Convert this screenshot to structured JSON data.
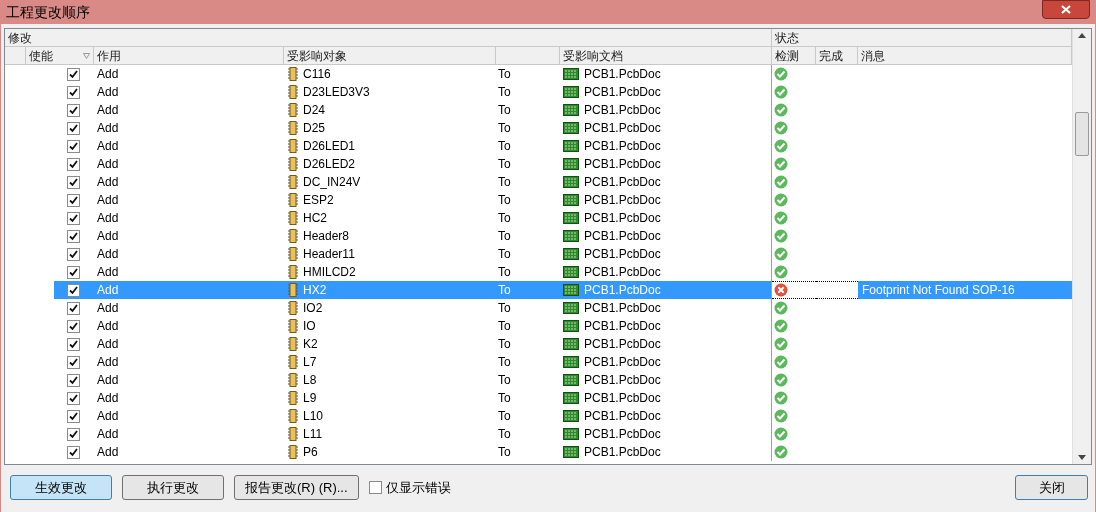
{
  "window": {
    "title": "工程更改顺序"
  },
  "groups": [
    "修改",
    "状态"
  ],
  "columns": [
    "使能",
    "作用",
    "受影响对象",
    "受影响文档",
    "检测",
    "完成",
    "消息"
  ],
  "rows": [
    {
      "enabled": true,
      "action": "Add",
      "object": "C116",
      "to": "To",
      "document": "PCB1.PcbDoc",
      "check": {
        "kind": "ok"
      },
      "selected": false
    },
    {
      "enabled": true,
      "action": "Add",
      "object": "D23LED3V3",
      "to": "To",
      "document": "PCB1.PcbDoc",
      "check": {
        "kind": "ok"
      },
      "selected": false
    },
    {
      "enabled": true,
      "action": "Add",
      "object": "D24",
      "to": "To",
      "document": "PCB1.PcbDoc",
      "check": {
        "kind": "ok"
      },
      "selected": false
    },
    {
      "enabled": true,
      "action": "Add",
      "object": "D25",
      "to": "To",
      "document": "PCB1.PcbDoc",
      "check": {
        "kind": "ok"
      },
      "selected": false
    },
    {
      "enabled": true,
      "action": "Add",
      "object": "D26LED1",
      "to": "To",
      "document": "PCB1.PcbDoc",
      "check": {
        "kind": "ok"
      },
      "selected": false
    },
    {
      "enabled": true,
      "action": "Add",
      "object": "D26LED2",
      "to": "To",
      "document": "PCB1.PcbDoc",
      "check": {
        "kind": "ok"
      },
      "selected": false
    },
    {
      "enabled": true,
      "action": "Add",
      "object": "DC_IN24V",
      "to": "To",
      "document": "PCB1.PcbDoc",
      "check": {
        "kind": "ok"
      },
      "selected": false
    },
    {
      "enabled": true,
      "action": "Add",
      "object": "ESP2",
      "to": "To",
      "document": "PCB1.PcbDoc",
      "check": {
        "kind": "ok"
      },
      "selected": false
    },
    {
      "enabled": true,
      "action": "Add",
      "object": "HC2",
      "to": "To",
      "document": "PCB1.PcbDoc",
      "check": {
        "kind": "ok"
      },
      "selected": false
    },
    {
      "enabled": true,
      "action": "Add",
      "object": "Header8",
      "to": "To",
      "document": "PCB1.PcbDoc",
      "check": {
        "kind": "ok"
      },
      "selected": false
    },
    {
      "enabled": true,
      "action": "Add",
      "object": "Header11",
      "to": "To",
      "document": "PCB1.PcbDoc",
      "check": {
        "kind": "ok"
      },
      "selected": false
    },
    {
      "enabled": true,
      "action": "Add",
      "object": "HMILCD2",
      "to": "To",
      "document": "PCB1.PcbDoc",
      "check": {
        "kind": "ok"
      },
      "selected": false
    },
    {
      "enabled": true,
      "action": "Add",
      "object": "HX2",
      "to": "To",
      "document": "PCB1.PcbDoc",
      "check": {
        "kind": "error"
      },
      "message": "Footprint Not Found SOP-16",
      "selected": true
    },
    {
      "enabled": true,
      "action": "Add",
      "object": "IO2",
      "to": "To",
      "document": "PCB1.PcbDoc",
      "check": {
        "kind": "ok"
      },
      "selected": false
    },
    {
      "enabled": true,
      "action": "Add",
      "object": "IO",
      "to": "To",
      "document": "PCB1.PcbDoc",
      "check": {
        "kind": "ok"
      },
      "selected": false
    },
    {
      "enabled": true,
      "action": "Add",
      "object": "K2",
      "to": "To",
      "document": "PCB1.PcbDoc",
      "check": {
        "kind": "ok"
      },
      "selected": false
    },
    {
      "enabled": true,
      "action": "Add",
      "object": "L7",
      "to": "To",
      "document": "PCB1.PcbDoc",
      "check": {
        "kind": "ok"
      },
      "selected": false
    },
    {
      "enabled": true,
      "action": "Add",
      "object": "L8",
      "to": "To",
      "document": "PCB1.PcbDoc",
      "check": {
        "kind": "ok"
      },
      "selected": false
    },
    {
      "enabled": true,
      "action": "Add",
      "object": "L9",
      "to": "To",
      "document": "PCB1.PcbDoc",
      "check": {
        "kind": "ok"
      },
      "selected": false
    },
    {
      "enabled": true,
      "action": "Add",
      "object": "L10",
      "to": "To",
      "document": "PCB1.PcbDoc",
      "check": {
        "kind": "ok"
      },
      "selected": false
    },
    {
      "enabled": true,
      "action": "Add",
      "object": "L11",
      "to": "To",
      "document": "PCB1.PcbDoc",
      "check": {
        "kind": "ok"
      },
      "selected": false
    },
    {
      "enabled": true,
      "action": "Add",
      "object": "P6",
      "to": "To",
      "document": "PCB1.PcbDoc",
      "check": {
        "kind": "ok"
      },
      "selected": false
    }
  ],
  "buttons": [
    {
      "label": "生效更改",
      "focused": true
    },
    {
      "label": "执行更改",
      "focused": false
    },
    {
      "label": "报告更改(R) (R)...",
      "focused": false
    }
  ],
  "errors_only": {
    "label": "仅显示错误",
    "checked": false
  },
  "close_button": {
    "label": "关闭"
  }
}
